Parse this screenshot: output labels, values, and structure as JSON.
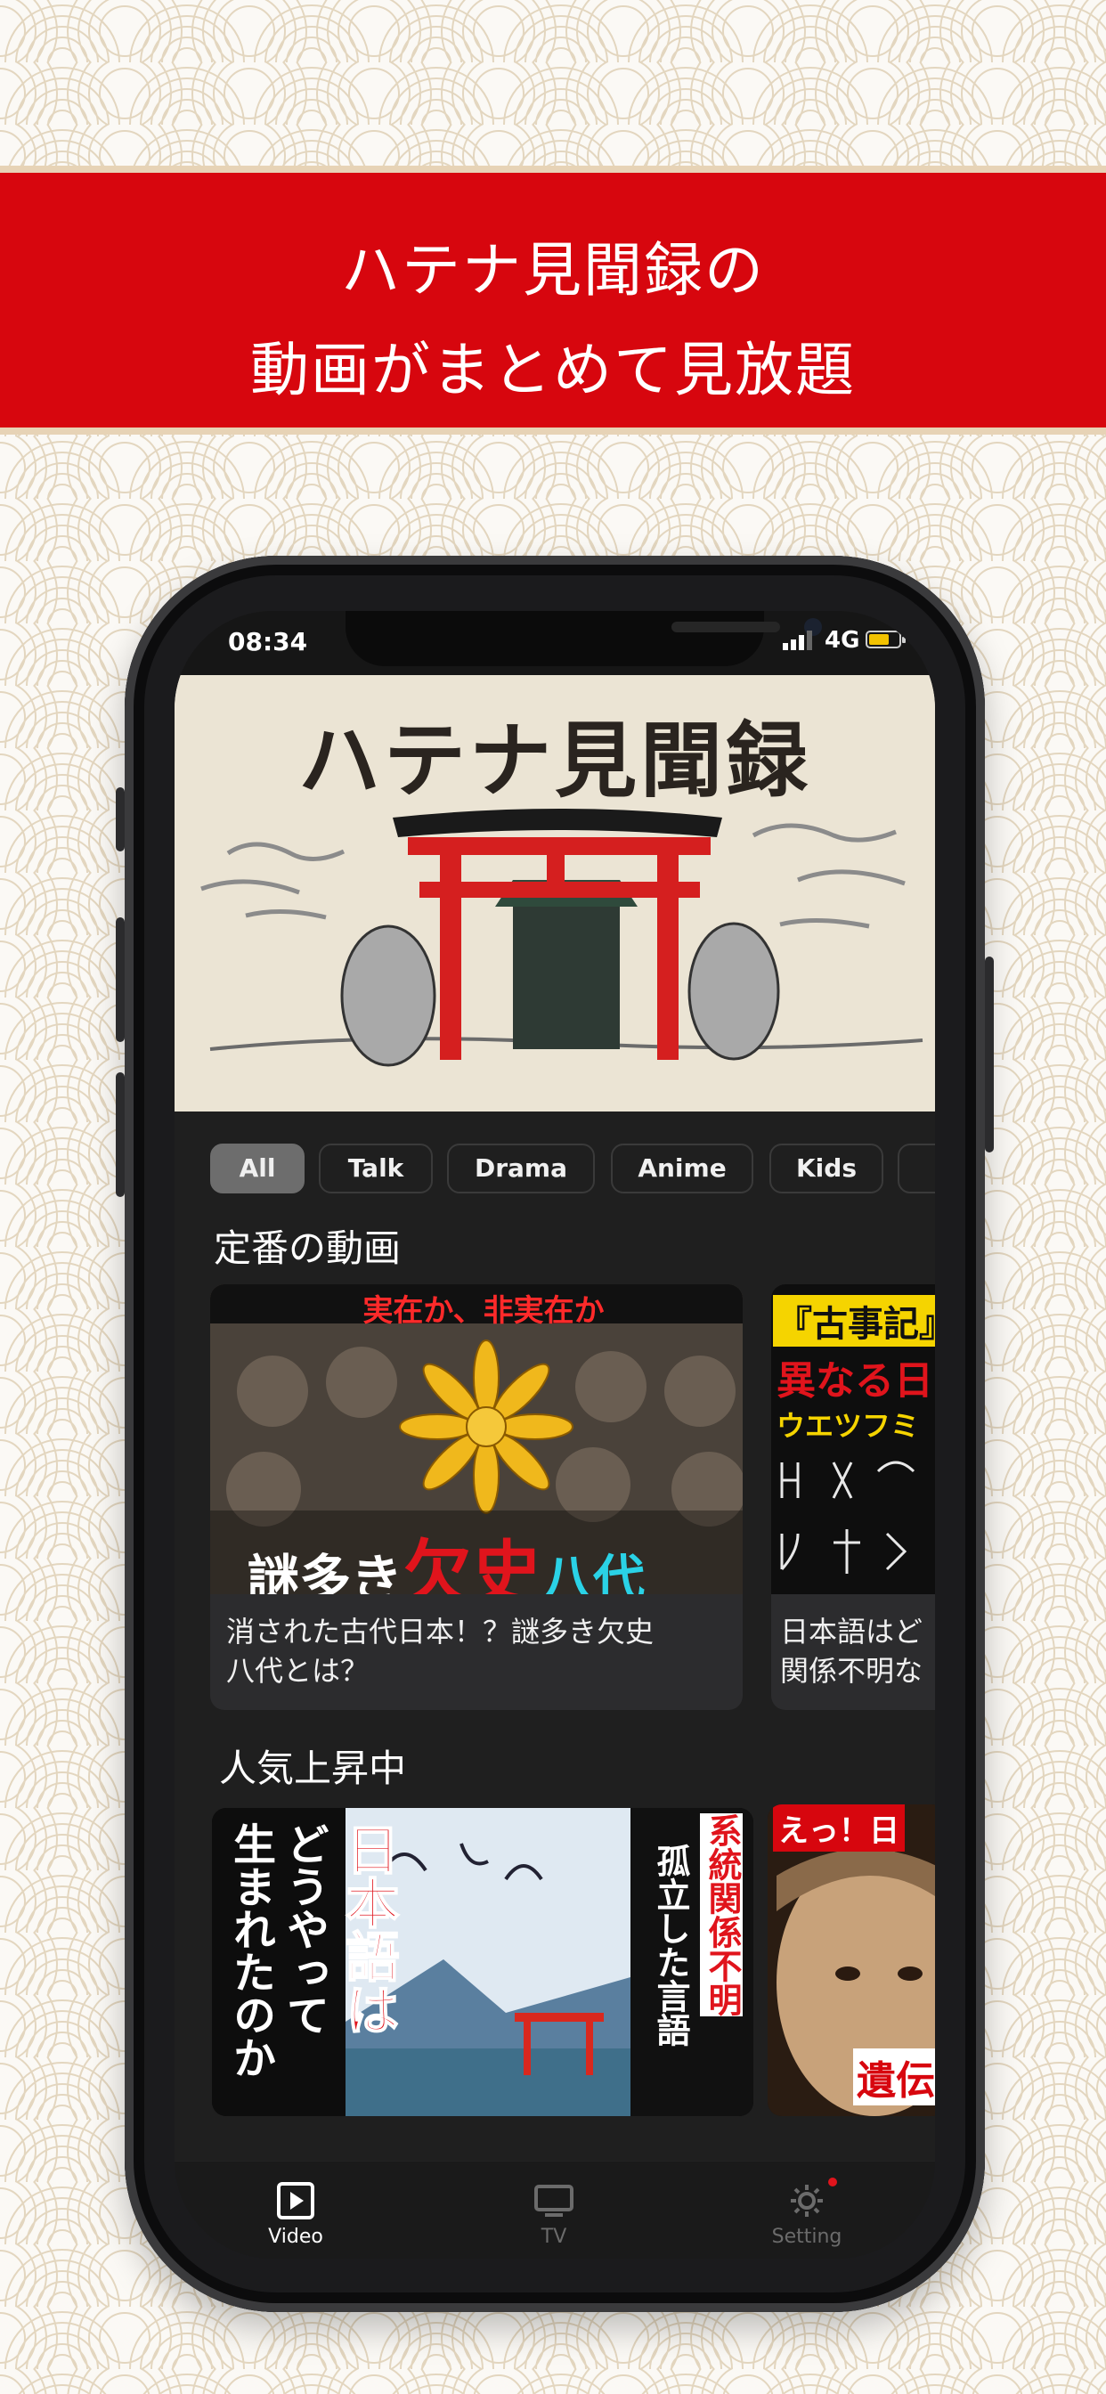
{
  "banner": {
    "line1": "ハテナ見聞録の",
    "line2": "動画がまとめて見放題"
  },
  "status": {
    "time": "08:34",
    "network": "4G"
  },
  "hero": {
    "title": "ハテナ見聞録"
  },
  "chips": [
    {
      "label": "All",
      "active": true
    },
    {
      "label": "Talk"
    },
    {
      "label": "Drama"
    },
    {
      "label": "Anime"
    },
    {
      "label": "Kids"
    }
  ],
  "sections": [
    {
      "title": "定番の動画",
      "cards": [
        {
          "thumb_top": "実在か、非実在か",
          "thumb_caption_a": "謎多き",
          "thumb_caption_b": "欠史",
          "thumb_caption_c": "八代",
          "title_line1": "消された古代日本！？謎多き欠史",
          "title_line2": "八代とは？"
        },
        {
          "thumb_line1": "『古事記』",
          "thumb_line2": "異なる日",
          "thumb_line3": "ウエツフミ",
          "title_line1": "日本語はど",
          "title_line2": "関係不明な"
        }
      ]
    },
    {
      "title": "人気上昇中",
      "cards": [
        {
          "col1": "生まれたのか",
          "col2": "どうやって",
          "col3": "日本語は",
          "col4": "系統関係不明",
          "col5": "孤立した言語"
        },
        {
          "thumb_top": "えっ！日",
          "thumb_bottom": "遺伝"
        }
      ]
    }
  ],
  "tabs": [
    {
      "label": "Video",
      "icon": "play-square-icon",
      "active": true
    },
    {
      "label": "TV",
      "icon": "tv-icon"
    },
    {
      "label": "Setting",
      "icon": "gear-icon"
    }
  ],
  "colors": {
    "banner_red": "#d7060e",
    "accent_red": "#e0141c",
    "tab_active": "#ffffff",
    "tab_inactive": "#6b6b6b"
  }
}
